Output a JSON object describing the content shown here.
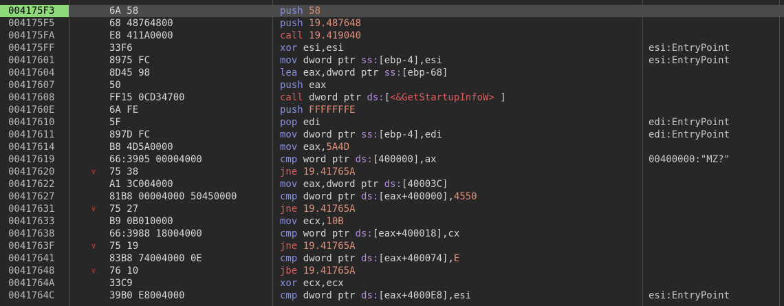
{
  "colors": {
    "background": "#272727",
    "selected_row": "#4a4a4a",
    "selected_address": "#8ed97a",
    "mnemonic": "#8a8fe0",
    "jump_mnemonic": "#e05a5a",
    "immediate": "#e3907a",
    "segment": "#b48ce0",
    "jump_arrow": "#d23535"
  },
  "jump_arrow_icon": "chevron-down-icon",
  "selected_index": 0,
  "rows": [
    {
      "addr": "004175F3",
      "bytes": "6A 58",
      "instr": [
        {
          "t": "push ",
          "c": "mov"
        },
        {
          "t": "58",
          "c": "num"
        }
      ],
      "comment": "",
      "jump": false
    },
    {
      "addr": "004175F5",
      "bytes": "68 48764800",
      "instr": [
        {
          "t": "push ",
          "c": "mov"
        },
        {
          "t": "19.487648",
          "c": "num"
        }
      ],
      "comment": "",
      "jump": false
    },
    {
      "addr": "004175FA",
      "bytes": "E8 411A0000",
      "instr": [
        {
          "t": "call ",
          "c": "call"
        },
        {
          "t": "19.419040",
          "c": "num"
        }
      ],
      "comment": "",
      "jump": false
    },
    {
      "addr": "004175FF",
      "bytes": "33F6",
      "instr": [
        {
          "t": "xor ",
          "c": "mov"
        },
        {
          "t": "esi,esi",
          "c": "op"
        }
      ],
      "comment": "esi:EntryPoint",
      "jump": false
    },
    {
      "addr": "00417601",
      "bytes": "8975 FC",
      "instr": [
        {
          "t": "mov ",
          "c": "mov"
        },
        {
          "t": "dword ptr ",
          "c": "op"
        },
        {
          "t": "ss:",
          "c": "seg"
        },
        {
          "t": "[ebp-4],esi",
          "c": "op"
        }
      ],
      "comment": "esi:EntryPoint",
      "jump": false
    },
    {
      "addr": "00417604",
      "bytes": "8D45 98",
      "instr": [
        {
          "t": "lea ",
          "c": "mov"
        },
        {
          "t": "eax,dword ptr ",
          "c": "op"
        },
        {
          "t": "ss:",
          "c": "seg"
        },
        {
          "t": "[ebp-68]",
          "c": "op"
        }
      ],
      "comment": "",
      "jump": false
    },
    {
      "addr": "00417607",
      "bytes": "50",
      "instr": [
        {
          "t": "push ",
          "c": "mov"
        },
        {
          "t": "eax",
          "c": "op"
        }
      ],
      "comment": "",
      "jump": false
    },
    {
      "addr": "00417608",
      "bytes": "FF15 0CD34700",
      "instr": [
        {
          "t": "call ",
          "c": "call"
        },
        {
          "t": "dword ptr ",
          "c": "op"
        },
        {
          "t": "ds:",
          "c": "seg"
        },
        {
          "t": "[",
          "c": "op"
        },
        {
          "t": "<&GetStartupInfoW>",
          "c": "sym"
        },
        {
          "t": " ]",
          "c": "op"
        }
      ],
      "comment": "",
      "jump": false
    },
    {
      "addr": "0041760E",
      "bytes": "6A FE",
      "instr": [
        {
          "t": "push ",
          "c": "mov"
        },
        {
          "t": "FFFFFFFE",
          "c": "num"
        }
      ],
      "comment": "",
      "jump": false
    },
    {
      "addr": "00417610",
      "bytes": "5F",
      "instr": [
        {
          "t": "pop ",
          "c": "mov"
        },
        {
          "t": "edi",
          "c": "op"
        }
      ],
      "comment": "edi:EntryPoint",
      "jump": false
    },
    {
      "addr": "00417611",
      "bytes": "897D FC",
      "instr": [
        {
          "t": "mov ",
          "c": "mov"
        },
        {
          "t": "dword ptr ",
          "c": "op"
        },
        {
          "t": "ss:",
          "c": "seg"
        },
        {
          "t": "[ebp-4],edi",
          "c": "op"
        }
      ],
      "comment": "edi:EntryPoint",
      "jump": false
    },
    {
      "addr": "00417614",
      "bytes": "B8 4D5A0000",
      "instr": [
        {
          "t": "mov ",
          "c": "mov"
        },
        {
          "t": "eax,",
          "c": "op"
        },
        {
          "t": "5A4D",
          "c": "num"
        }
      ],
      "comment": "",
      "jump": false
    },
    {
      "addr": "00417619",
      "bytes": "66:3905 00004000",
      "instr": [
        {
          "t": "cmp ",
          "c": "mov"
        },
        {
          "t": "word ptr ",
          "c": "op"
        },
        {
          "t": "ds:",
          "c": "seg"
        },
        {
          "t": "[400000],ax",
          "c": "op"
        }
      ],
      "comment": "00400000:\"MZ?\"",
      "jump": false
    },
    {
      "addr": "00417620",
      "bytes": "75 38",
      "instr": [
        {
          "t": "jne ",
          "c": "jmp"
        },
        {
          "t": "19.41765A",
          "c": "num"
        }
      ],
      "comment": "",
      "jump": true
    },
    {
      "addr": "00417622",
      "bytes": "A1 3C004000",
      "instr": [
        {
          "t": "mov ",
          "c": "mov"
        },
        {
          "t": "eax,dword ptr ",
          "c": "op"
        },
        {
          "t": "ds:",
          "c": "seg"
        },
        {
          "t": "[40003C]",
          "c": "op"
        }
      ],
      "comment": "",
      "jump": false
    },
    {
      "addr": "00417627",
      "bytes": "81B8 00004000 50450000",
      "instr": [
        {
          "t": "cmp ",
          "c": "mov"
        },
        {
          "t": "dword ptr ",
          "c": "op"
        },
        {
          "t": "ds:",
          "c": "seg"
        },
        {
          "t": "[eax+400000],",
          "c": "op"
        },
        {
          "t": "4550",
          "c": "num"
        }
      ],
      "comment": "",
      "jump": false
    },
    {
      "addr": "00417631",
      "bytes": "75 27",
      "instr": [
        {
          "t": "jne ",
          "c": "jmp"
        },
        {
          "t": "19.41765A",
          "c": "num"
        }
      ],
      "comment": "",
      "jump": true
    },
    {
      "addr": "00417633",
      "bytes": "B9 0B010000",
      "instr": [
        {
          "t": "mov ",
          "c": "mov"
        },
        {
          "t": "ecx,",
          "c": "op"
        },
        {
          "t": "10B",
          "c": "num"
        }
      ],
      "comment": "",
      "jump": false
    },
    {
      "addr": "00417638",
      "bytes": "66:3988 18004000",
      "instr": [
        {
          "t": "cmp ",
          "c": "mov"
        },
        {
          "t": "word ptr ",
          "c": "op"
        },
        {
          "t": "ds:",
          "c": "seg"
        },
        {
          "t": "[eax+400018],cx",
          "c": "op"
        }
      ],
      "comment": "",
      "jump": false
    },
    {
      "addr": "0041763F",
      "bytes": "75 19",
      "instr": [
        {
          "t": "jne ",
          "c": "jmp"
        },
        {
          "t": "19.41765A",
          "c": "num"
        }
      ],
      "comment": "",
      "jump": true
    },
    {
      "addr": "00417641",
      "bytes": "83B8 74004000 0E",
      "instr": [
        {
          "t": "cmp ",
          "c": "mov"
        },
        {
          "t": "dword ptr ",
          "c": "op"
        },
        {
          "t": "ds:",
          "c": "seg"
        },
        {
          "t": "[eax+400074],",
          "c": "op"
        },
        {
          "t": "E",
          "c": "num"
        }
      ],
      "comment": "",
      "jump": false
    },
    {
      "addr": "00417648",
      "bytes": "76 10",
      "instr": [
        {
          "t": "jbe ",
          "c": "jmp"
        },
        {
          "t": "19.41765A",
          "c": "num"
        }
      ],
      "comment": "",
      "jump": true
    },
    {
      "addr": "0041764A",
      "bytes": "33C9",
      "instr": [
        {
          "t": "xor ",
          "c": "mov"
        },
        {
          "t": "ecx,ecx",
          "c": "op"
        }
      ],
      "comment": "",
      "jump": false
    },
    {
      "addr": "0041764C",
      "bytes": "39B0 E8004000",
      "instr": [
        {
          "t": "cmp ",
          "c": "mov"
        },
        {
          "t": "dword ptr ",
          "c": "op"
        },
        {
          "t": "ds:",
          "c": "seg"
        },
        {
          "t": "[eax+4000E8],esi",
          "c": "op"
        }
      ],
      "comment": "esi:EntryPoint",
      "jump": false
    }
  ]
}
